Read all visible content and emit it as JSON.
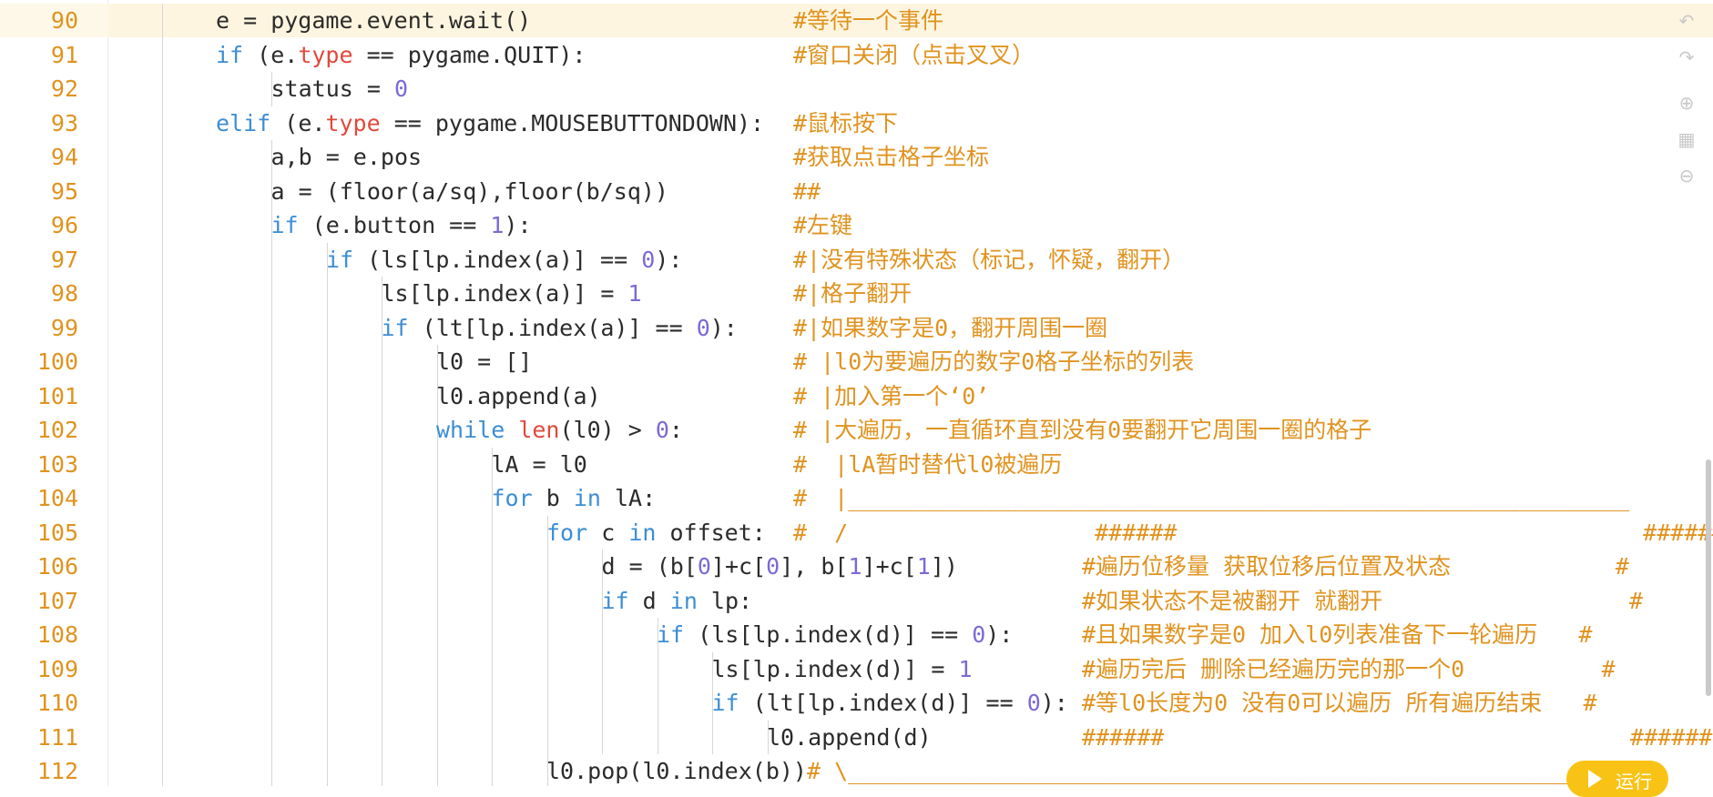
{
  "lines": [
    {
      "n": "90",
      "indent": 2,
      "code": [
        [
          "op",
          "e = pygame.event.wait()"
        ]
      ],
      "cmt": "#等待一个事件",
      "cmtCol": 871,
      "active": true
    },
    {
      "n": "91",
      "indent": 2,
      "code": [
        [
          "kw",
          "if"
        ],
        [
          "op",
          " (e."
        ],
        [
          "fn",
          "type"
        ],
        [
          "op",
          " == pygame.QUIT):"
        ]
      ],
      "cmt": "#窗口关闭（点击叉叉）",
      "cmtCol": 871
    },
    {
      "n": "92",
      "indent": 3,
      "code": [
        [
          "op",
          "status = "
        ],
        [
          "num",
          "0"
        ]
      ],
      "cmt": "",
      "cmtCol": 871
    },
    {
      "n": "93",
      "indent": 2,
      "code": [
        [
          "kw",
          "elif"
        ],
        [
          "op",
          " (e."
        ],
        [
          "fn",
          "type"
        ],
        [
          "op",
          " == pygame.MOUSEBUTTONDOWN):"
        ]
      ],
      "cmt": "#鼠标按下",
      "cmtCol": 871
    },
    {
      "n": "94",
      "indent": 3,
      "code": [
        [
          "op",
          "a,b = e.pos"
        ]
      ],
      "cmt": "#获取点击格子坐标",
      "cmtCol": 871
    },
    {
      "n": "95",
      "indent": 3,
      "code": [
        [
          "op",
          "a = (floor(a/sq),floor(b/sq))"
        ]
      ],
      "cmt": "##",
      "cmtCol": 871
    },
    {
      "n": "96",
      "indent": 3,
      "code": [
        [
          "kw",
          "if"
        ],
        [
          "op",
          " (e.button == "
        ],
        [
          "num",
          "1"
        ],
        [
          "op",
          "):"
        ]
      ],
      "cmt": "#左键",
      "cmtCol": 871
    },
    {
      "n": "97",
      "indent": 4,
      "code": [
        [
          "kw",
          "if"
        ],
        [
          "op",
          " (ls[lp.index(a)] == "
        ],
        [
          "num",
          "0"
        ],
        [
          "op",
          "):"
        ]
      ],
      "cmt": "#|没有特殊状态（标记，怀疑，翻开）",
      "cmtCol": 871
    },
    {
      "n": "98",
      "indent": 5,
      "code": [
        [
          "op",
          "ls[lp.index(a)] = "
        ],
        [
          "num",
          "1"
        ]
      ],
      "cmt": "#|格子翻开",
      "cmtCol": 871
    },
    {
      "n": "99",
      "indent": 5,
      "code": [
        [
          "kw",
          "if"
        ],
        [
          "op",
          " (lt[lp.index(a)] == "
        ],
        [
          "num",
          "0"
        ],
        [
          "op",
          "):"
        ]
      ],
      "cmt": "#|如果数字是0，翻开周围一圈",
      "cmtCol": 871
    },
    {
      "n": "100",
      "indent": 6,
      "code": [
        [
          "op",
          "l0 = []"
        ]
      ],
      "cmt": "# |l0为要遍历的数字0格子坐标的列表",
      "cmtCol": 871
    },
    {
      "n": "101",
      "indent": 6,
      "code": [
        [
          "op",
          "l0.append(a)"
        ]
      ],
      "cmt": "# |加入第一个‘0’",
      "cmtCol": 871
    },
    {
      "n": "102",
      "indent": 6,
      "code": [
        [
          "kw",
          "while"
        ],
        [
          "op",
          " "
        ],
        [
          "fn",
          "len"
        ],
        [
          "op",
          "(l0) > "
        ],
        [
          "num",
          "0"
        ],
        [
          "op",
          ":"
        ]
      ],
      "cmt": "# |大遍历，一直循环直到没有0要翻开它周围一圈的格子",
      "cmtCol": 871
    },
    {
      "n": "103",
      "indent": 7,
      "code": [
        [
          "op",
          "lA = l0"
        ]
      ],
      "cmt": "#  |lA暂时替代l0被遍历",
      "cmtCol": 871
    },
    {
      "n": "104",
      "indent": 7,
      "code": [
        [
          "kw",
          "for"
        ],
        [
          "op",
          " b "
        ],
        [
          "kw",
          "in"
        ],
        [
          "op",
          " lA:"
        ]
      ],
      "cmt": "#  |_________________________________________________________",
      "cmtCol": 871
    },
    {
      "n": "105",
      "indent": 8,
      "code": [
        [
          "kw",
          "for"
        ],
        [
          "op",
          " c "
        ],
        [
          "kw",
          "in"
        ],
        [
          "op",
          " offset:"
        ]
      ],
      "cmt": "#  /                  ######                                  ######",
      "cmtCol": 871
    },
    {
      "n": "106",
      "indent": 9,
      "code": [
        [
          "op",
          "d = (b["
        ],
        [
          "num",
          "0"
        ],
        [
          "op",
          "]+c["
        ],
        [
          "num",
          "0"
        ],
        [
          "op",
          "], b["
        ],
        [
          "num",
          "1"
        ],
        [
          "op",
          "]+c["
        ],
        [
          "num",
          "1"
        ],
        [
          "op",
          "])"
        ]
      ],
      "cmt": "#遍历位移量 获取位移后位置及状态            #",
      "cmtCol": 1188
    },
    {
      "n": "107",
      "indent": 9,
      "code": [
        [
          "kw",
          "if"
        ],
        [
          "op",
          " d "
        ],
        [
          "kw",
          "in"
        ],
        [
          "op",
          " lp:"
        ]
      ],
      "cmt": "#如果状态不是被翻开 就翻开                  #",
      "cmtCol": 1188
    },
    {
      "n": "108",
      "indent": 10,
      "code": [
        [
          "kw",
          "if"
        ],
        [
          "op",
          " (ls[lp.index(d)] == "
        ],
        [
          "num",
          "0"
        ],
        [
          "op",
          "):"
        ]
      ],
      "cmt": "#且如果数字是0 加入l0列表准备下一轮遍历   #",
      "cmtCol": 1188
    },
    {
      "n": "109",
      "indent": 11,
      "code": [
        [
          "op",
          "ls[lp.index(d)] = "
        ],
        [
          "num",
          "1"
        ]
      ],
      "cmt": "#遍历完后 删除已经遍历完的那一个0          #",
      "cmtCol": 1188
    },
    {
      "n": "110",
      "indent": 11,
      "code": [
        [
          "kw",
          "if"
        ],
        [
          "op",
          " (lt[lp.index(d)] == "
        ],
        [
          "num",
          "0"
        ],
        [
          "op",
          "):"
        ]
      ],
      "cmt": "#等l0长度为0 没有0可以遍历 所有遍历结束   #",
      "cmtCol": 1188
    },
    {
      "n": "111",
      "indent": 12,
      "code": [
        [
          "op",
          "l0.append(d)"
        ]
      ],
      "cmt": "######                                  ######",
      "cmtCol": 1188
    },
    {
      "n": "112",
      "indent": 8,
      "code": [
        [
          "op",
          "l0.pop(l0.index(b))"
        ],
        [
          "cmtinline",
          "# \\________________________________________________________"
        ]
      ],
      "cmt": "",
      "cmtCol": 871
    }
  ],
  "side_icons": [
    "undo-icon",
    "redo-icon",
    "zoom-in-icon",
    "format-icon",
    "zoom-out-icon"
  ],
  "run_button": {
    "label": "运行"
  }
}
